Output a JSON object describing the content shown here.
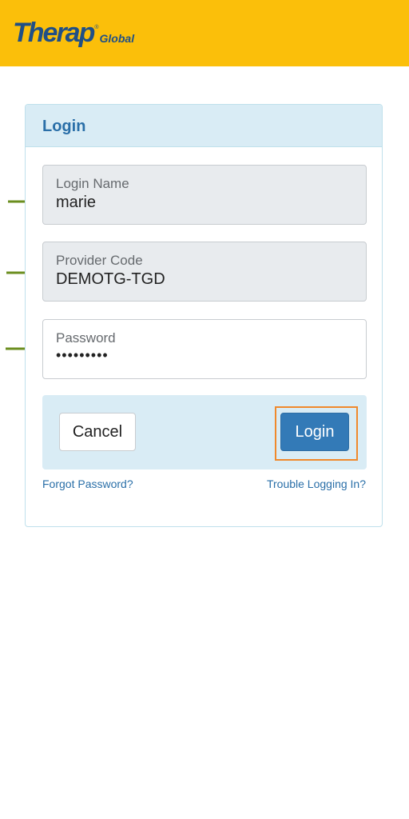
{
  "header": {
    "logo_main": "Therap",
    "logo_reg": "®",
    "logo_sub": "Global",
    "background_color": "#fbbf0a"
  },
  "login_card": {
    "title": "Login",
    "fields": [
      {
        "label": "Login Name",
        "value": "marie",
        "type": "text"
      },
      {
        "label": "Provider Code",
        "value": "DEMOTG-TGD",
        "type": "text"
      },
      {
        "label": "Password",
        "value": "•••••••••",
        "type": "password"
      }
    ],
    "cancel_label": "Cancel",
    "login_label": "Login",
    "forgot_password": "Forgot Password?",
    "trouble_logging_in": "Trouble Logging In?"
  },
  "annotations": {
    "arrow_color": "#6b8e1f",
    "highlight_color": "#f0892c",
    "icons": [
      "arrow-right-icon",
      "arrow-right-icon",
      "arrow-right-icon"
    ]
  },
  "colors": {
    "accent": "#337ab7",
    "card_header_bg": "#d9ecf5",
    "title_color": "#2a6fa8"
  }
}
